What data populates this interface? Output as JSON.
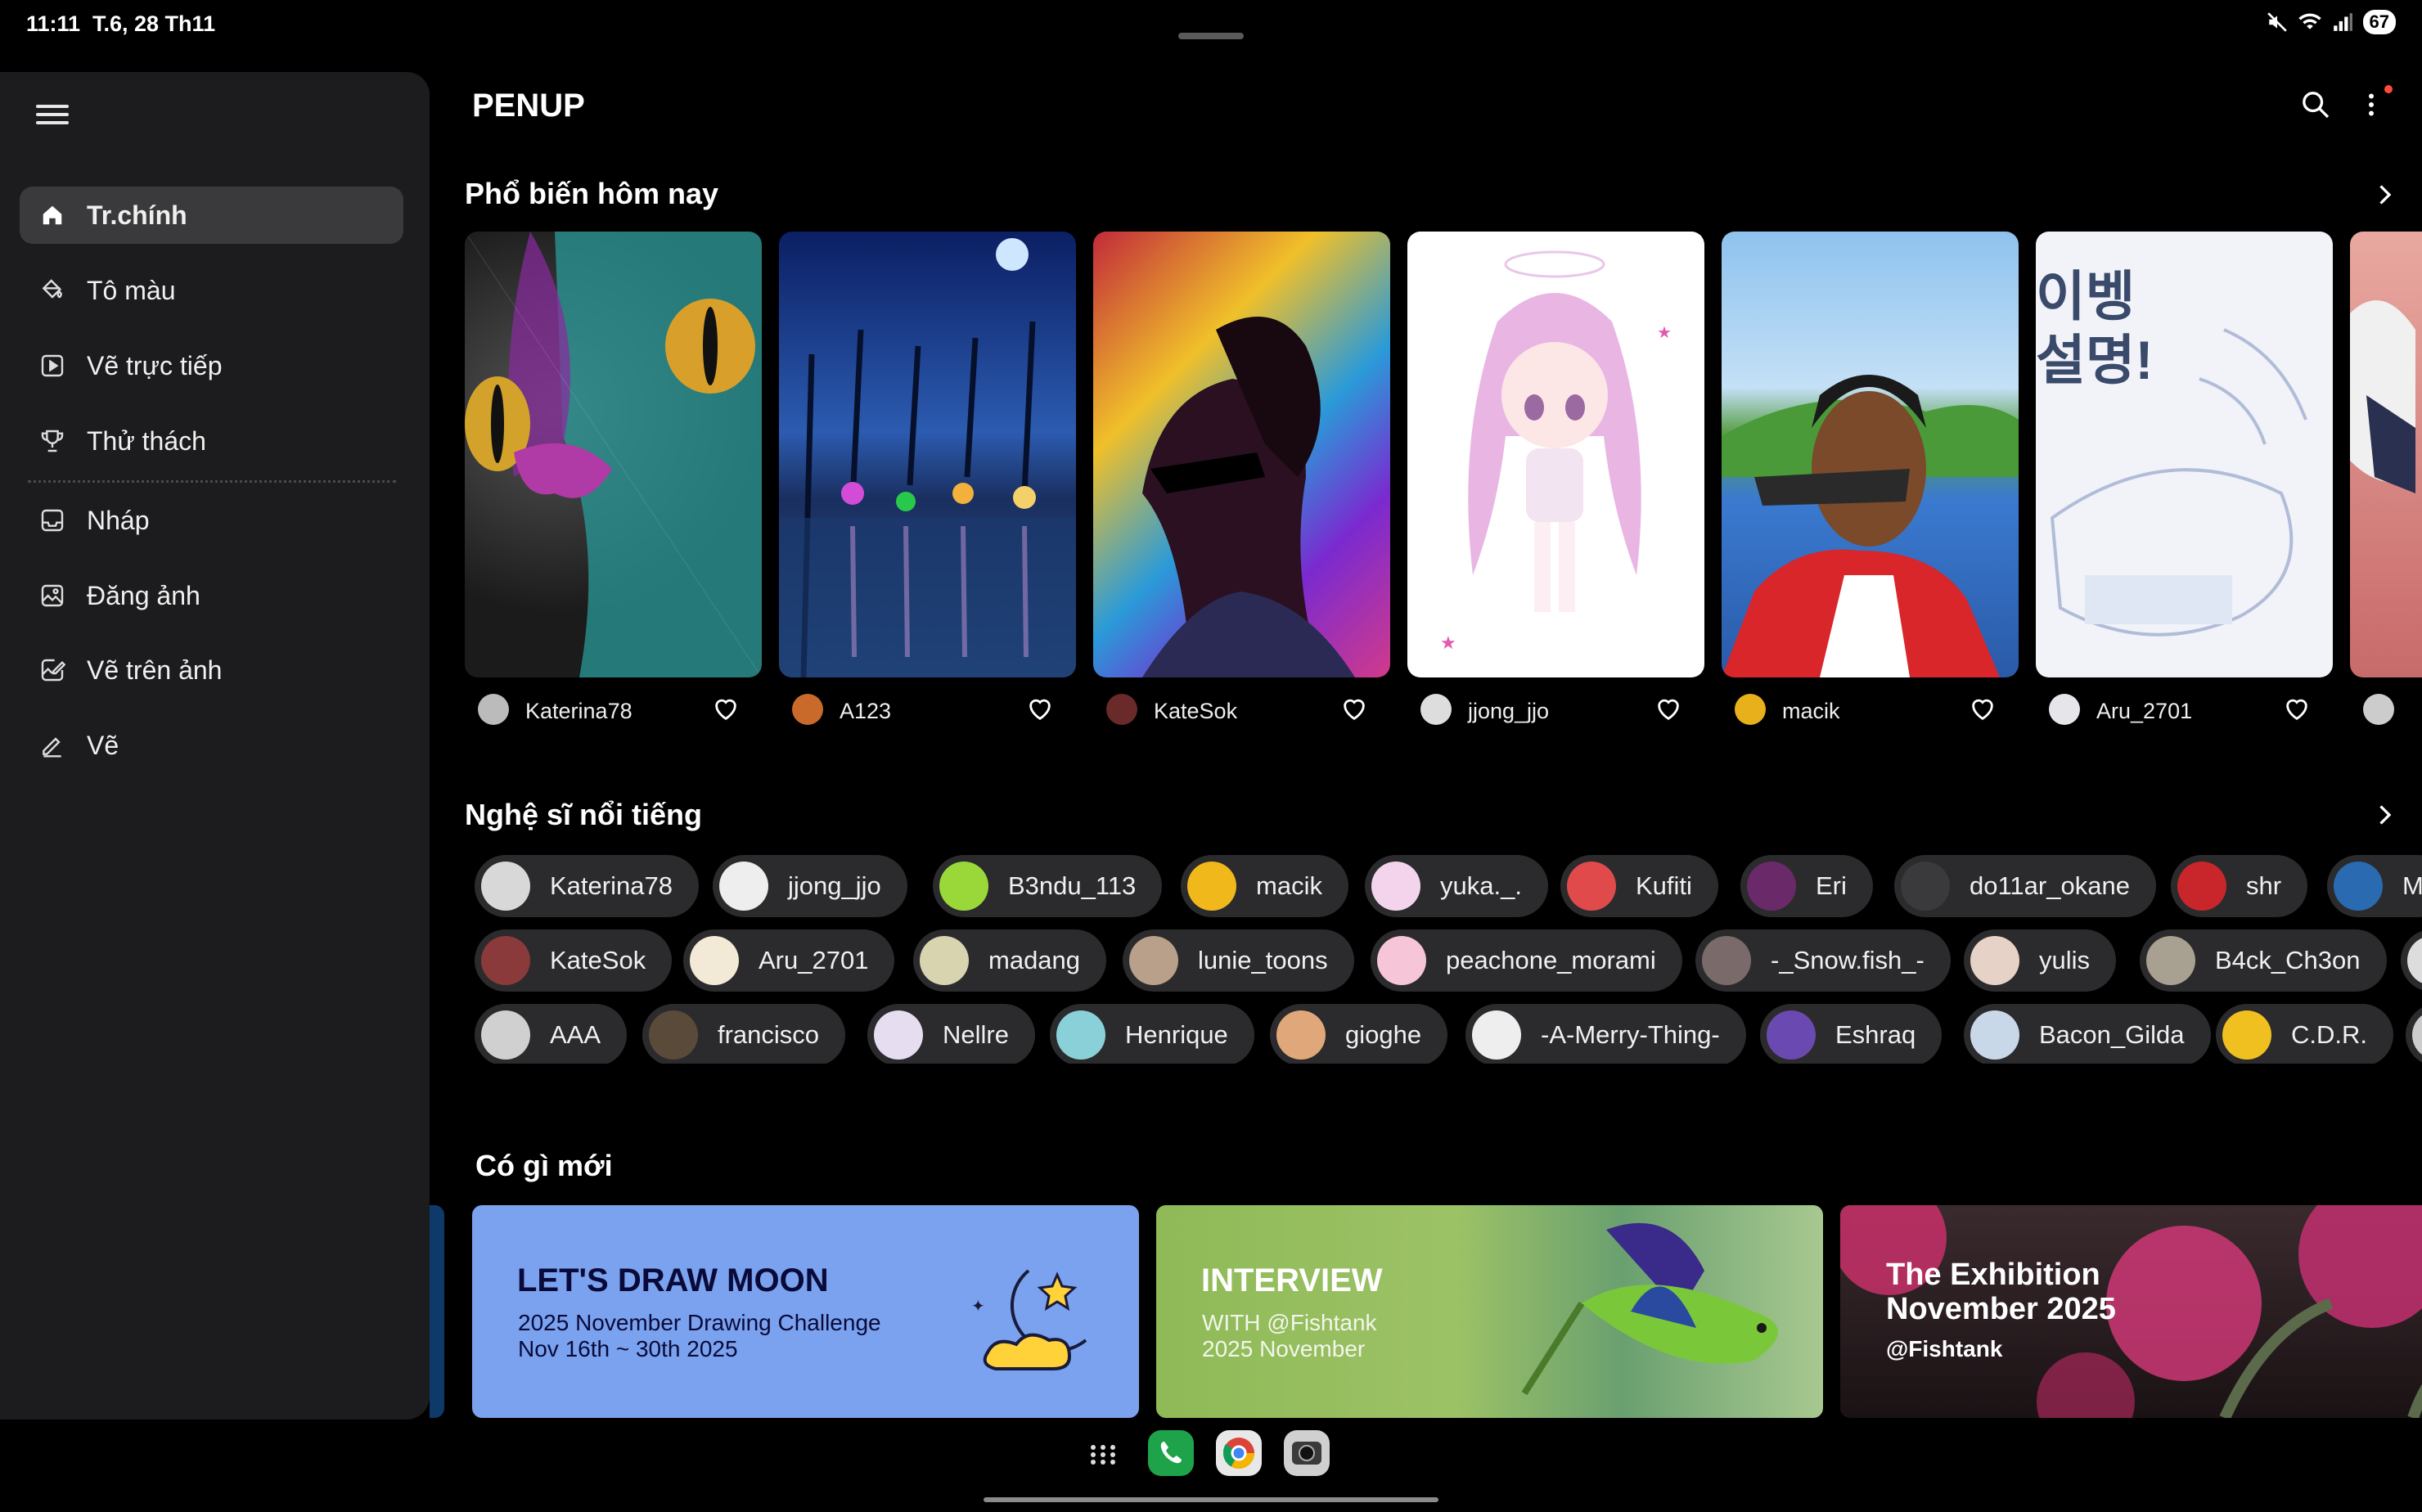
{
  "status": {
    "time": "11:11",
    "date": "T.6, 28 Th11",
    "battery": "67"
  },
  "app": {
    "title": "PENUP"
  },
  "sidebar": {
    "items": [
      {
        "label": "Tr.chính",
        "icon": "home-icon",
        "active": true
      },
      {
        "label": "Tô màu",
        "icon": "paint-bucket-icon"
      },
      {
        "label": "Vẽ trực tiếp",
        "icon": "live-play-icon"
      },
      {
        "label": "Thử thách",
        "icon": "trophy-icon"
      },
      {
        "label": "Nháp",
        "icon": "drafts-tray-icon"
      },
      {
        "label": "Đăng ảnh",
        "icon": "image-upload-icon"
      },
      {
        "label": "Vẽ trên ảnh",
        "icon": "draw-on-photo-icon"
      },
      {
        "label": "Vẽ",
        "icon": "pen-icon"
      }
    ]
  },
  "popular": {
    "title": "Phổ biến hôm nay",
    "cards": [
      {
        "author": "Katerina78"
      },
      {
        "author": "A123"
      },
      {
        "author": "KateSok"
      },
      {
        "author": "jjong_jjo"
      },
      {
        "author": "macik"
      },
      {
        "author": "Aru_2701"
      },
      {
        "author": ""
      }
    ],
    "card_text": {
      "aru_art": "이벵\n설명!"
    }
  },
  "artists": {
    "title": "Nghệ sĩ nổi tiếng",
    "rows": [
      [
        "Katerina78",
        "jjong_jjo",
        "B3ndu_113",
        "macik",
        "yuka._.",
        "Kufiti",
        "Eri",
        "do11ar_okane",
        "shr",
        "M"
      ],
      [
        "KateSok",
        "Aru_2701",
        "madang",
        "lunie_toons",
        "peachone_morami",
        "-_Snow.fish_-",
        "yulis",
        "B4ck_Ch3on",
        ""
      ],
      [
        "AAA",
        "francisco",
        "Nellre",
        "Henrique",
        "gioghe",
        "-A-Merry-Thing-",
        "Eshraq",
        "Bacon_Gilda",
        "C.D.R.",
        ""
      ]
    ]
  },
  "whats_new": {
    "title": "Có gì mới",
    "banners": [
      {
        "title": "LET'S DRAW MOON",
        "line1": "2025 November Drawing Challenge",
        "line2": "Nov 16th ~ 30th 2025"
      },
      {
        "title": "INTERVIEW",
        "line1": "WITH @Fishtank",
        "line2": "2025 November"
      },
      {
        "title": "The Exhibition",
        "line1": "November 2025",
        "line2": "@Fishtank"
      }
    ]
  },
  "colors": {
    "background": "#000000",
    "sidebar": "#1c1c1e",
    "chip": "#2b2b2d",
    "moon_banner": "#7aa2ee",
    "interview_banner": "#8fba57"
  }
}
